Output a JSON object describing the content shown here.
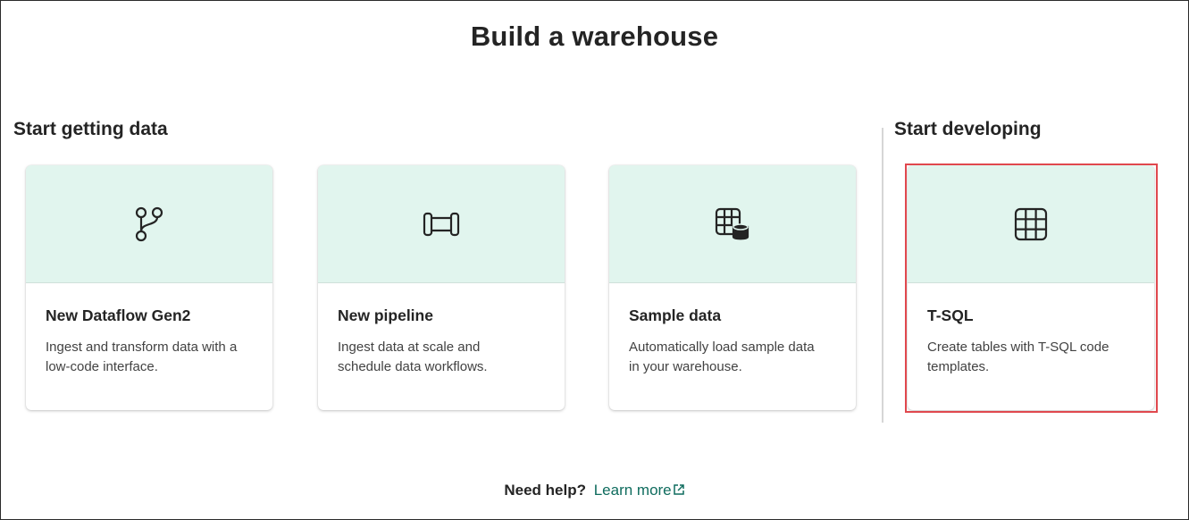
{
  "page": {
    "title": "Build a warehouse"
  },
  "sections": {
    "getting_data": {
      "heading": "Start getting data"
    },
    "developing": {
      "heading": "Start developing"
    }
  },
  "cards": [
    {
      "icon": "branch-icon",
      "title": "New Dataflow Gen2",
      "desc_line1": "Ingest and transform data with a",
      "desc_line2": "low-code interface."
    },
    {
      "icon": "pipeline-icon",
      "title": "New pipeline",
      "desc_line1": "Ingest data at scale and",
      "desc_line2": "schedule data workflows."
    },
    {
      "icon": "table-database-icon",
      "title": "Sample data",
      "desc_line1": "Automatically load sample data",
      "desc_line2": "in your warehouse."
    },
    {
      "icon": "table-grid-icon",
      "title": "T-SQL",
      "desc_line1": "Create tables with T-SQL code",
      "desc_line2": "templates.",
      "highlighted": true
    }
  ],
  "help": {
    "label": "Need help?",
    "link_text": "Learn more",
    "link_icon": "open-external-icon"
  },
  "colors": {
    "card_header_bg": "#e1f5ee",
    "link": "#0f6c5e",
    "highlight_border": "#e0484e"
  }
}
